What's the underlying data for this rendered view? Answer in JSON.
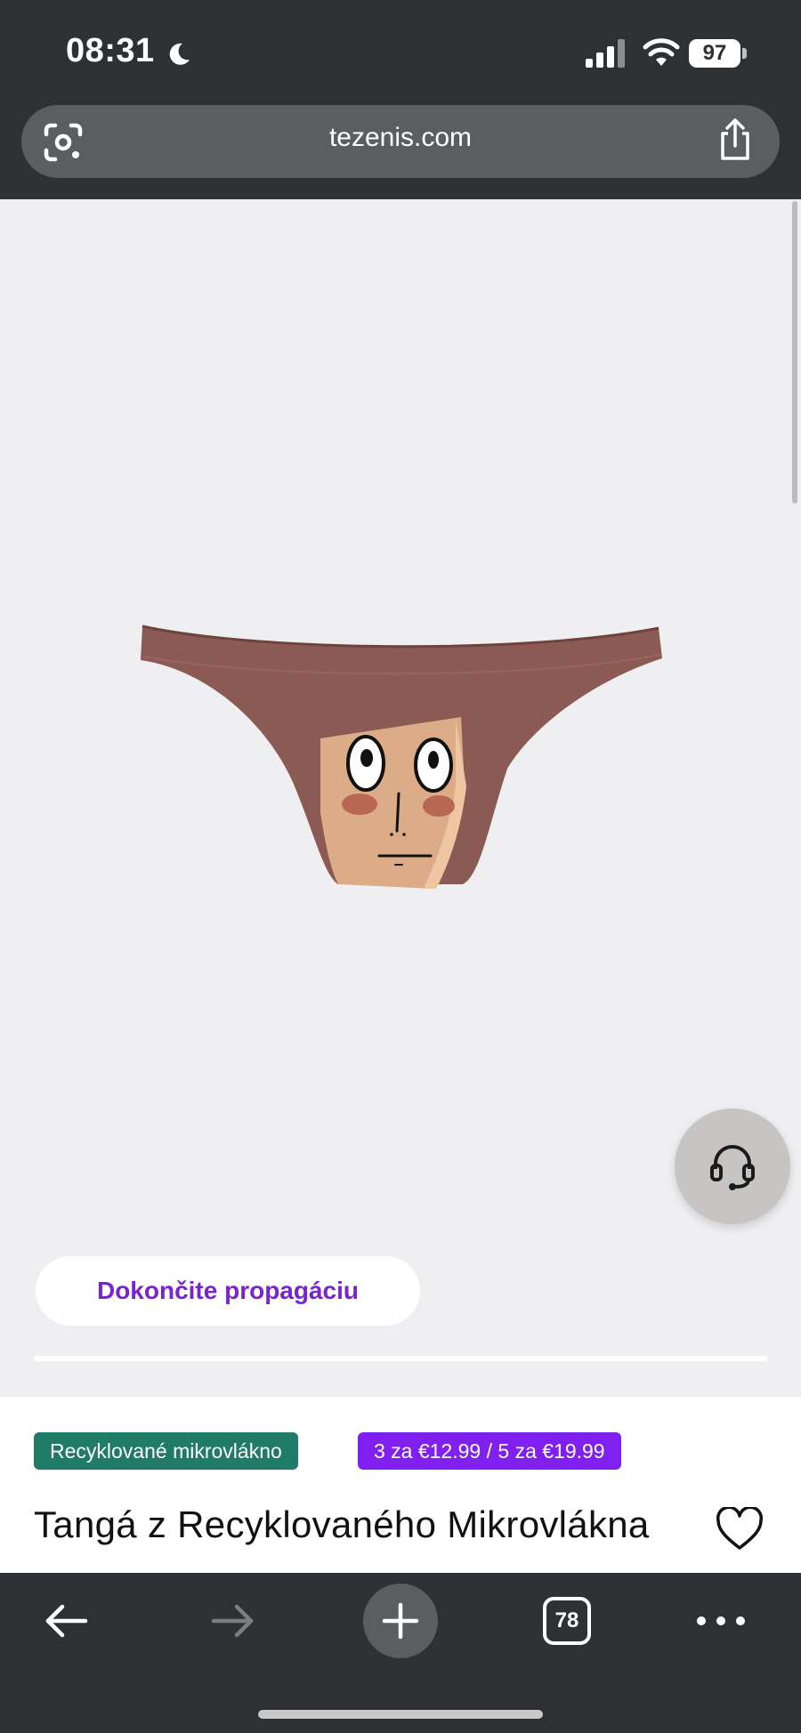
{
  "status_bar": {
    "time": "08:31",
    "battery": "97",
    "icons": [
      "moon-icon",
      "cellular-signal-icon",
      "wifi-icon",
      "battery-icon"
    ]
  },
  "address_bar": {
    "url": "tezenis.com",
    "icons": [
      "google-lens-icon",
      "share-icon"
    ]
  },
  "product": {
    "image": "brown-thong-with-drawn-face",
    "colors": {
      "fabric": "#8c5a54",
      "skin": "#dcab88"
    },
    "promo_button": "Dokončite propagáciu",
    "badges": [
      "Recyklované mikrovlákno",
      "3 za €12.99 / 5 za €19.99"
    ],
    "title": "Tangá z Recyklovaného Mikrovlákna",
    "badge_colors": {
      "material": "#1f7a68",
      "offer": "#7f1ff0"
    }
  },
  "support": {
    "icon": "headset-icon"
  },
  "toolbar": {
    "tabs_count": "78",
    "icons": [
      "back-arrow-icon",
      "forward-arrow-icon",
      "plus-icon",
      "tabs-icon",
      "more-icon"
    ]
  }
}
